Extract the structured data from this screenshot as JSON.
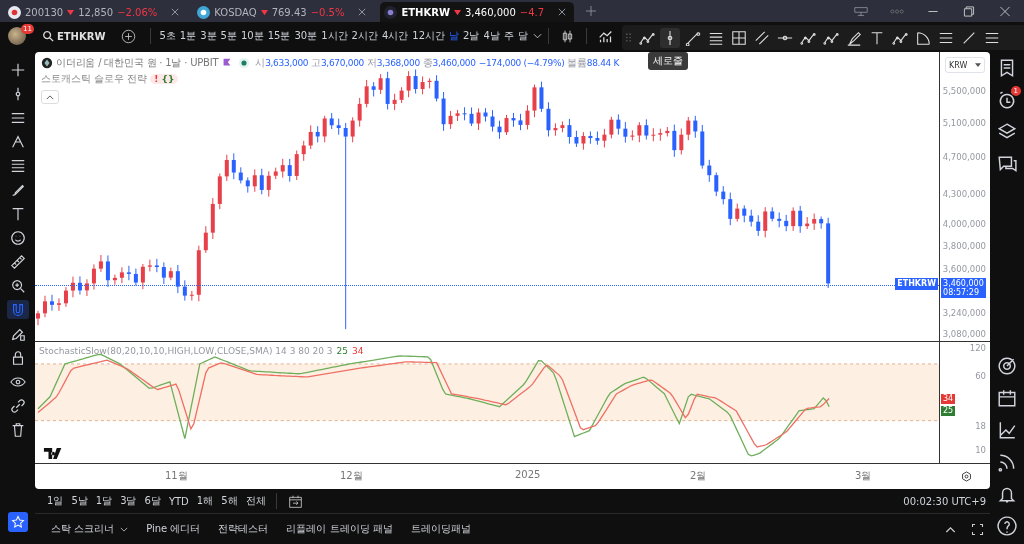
{
  "tabs": [
    {
      "symbol": "200130",
      "price": "12,850",
      "change": "−2.06%",
      "selected": false
    },
    {
      "symbol": "KOSDAQ",
      "price": "769.43",
      "change": "−0.5%",
      "selected": false
    },
    {
      "symbol": "ETHKRW",
      "price": "3,460,000",
      "change": "−4.7",
      "selected": true
    }
  ],
  "toolbar": {
    "avatar_badge": "11",
    "symbol": "ETHKRW",
    "intervals": [
      {
        "label": "5초",
        "selected": false
      },
      {
        "label": "1분",
        "selected": false
      },
      {
        "label": "3분",
        "selected": false
      },
      {
        "label": "5분",
        "selected": false
      },
      {
        "label": "10분",
        "selected": false
      },
      {
        "label": "15분",
        "selected": false
      },
      {
        "label": "30분",
        "selected": false
      },
      {
        "label": "1시간",
        "selected": false
      },
      {
        "label": "2시간",
        "selected": false
      },
      {
        "label": "4시간",
        "selected": false
      },
      {
        "label": "12시간",
        "selected": false
      },
      {
        "label": "날",
        "selected": true
      },
      {
        "label": "2날",
        "selected": false
      },
      {
        "label": "4날",
        "selected": false
      },
      {
        "label": "주",
        "selected": false
      },
      {
        "label": "달",
        "selected": false
      }
    ],
    "tooltip": "세로줄"
  },
  "legend": {
    "title": "이더리움 / 대한민국 원 · 1날 · UPBIT",
    "ohlc": [
      {
        "label": "시",
        "value": "3,633,000"
      },
      {
        "label": "고",
        "value": "3,670,000"
      },
      {
        "label": "저",
        "value": "3,368,000"
      },
      {
        "label": "종",
        "value": "3,460,000"
      }
    ],
    "change": "−174,000 (−4.79%)",
    "volume_label": "볼륨",
    "volume": "88.44 K",
    "strategy": "스토캐스틱 슬로우 전략",
    "strategy_badges": [
      "!",
      "{}"
    ]
  },
  "price_axis": {
    "currency": "KRW",
    "ticks": [
      "5,500,000",
      "5,100,000",
      "4,700,000",
      "4,300,000",
      "4,000,000",
      "3,800,000",
      "3,600,000",
      "3,240,000",
      "3,080,000"
    ],
    "symbol_tag": "ETHKRW",
    "last_price": "3,460,000",
    "countdown": "08:57:29"
  },
  "indicator": {
    "title": "StochasticSlow(80,20,10,10,HIGH,LOW,CLOSE,SMA) 14 3 80 20 3",
    "k": "25",
    "d": "34",
    "k_tag": "25",
    "d_tag": "34",
    "ticks": [
      "120",
      "60",
      "18",
      "10"
    ]
  },
  "time_axis": [
    "11월",
    "12월",
    "2025",
    "2월",
    "3월"
  ],
  "ranges": [
    "1일",
    "5날",
    "1달",
    "3달",
    "6달",
    "YTD",
    "1해",
    "5해",
    "전체"
  ],
  "clock": "00:02:30 UTC+9",
  "panels": [
    "스탁 스크리너",
    "Pine 에디터",
    "전략테스터",
    "리플레이 트레이딩 패널",
    "트레이딩패널"
  ],
  "alert_badge": "1"
}
